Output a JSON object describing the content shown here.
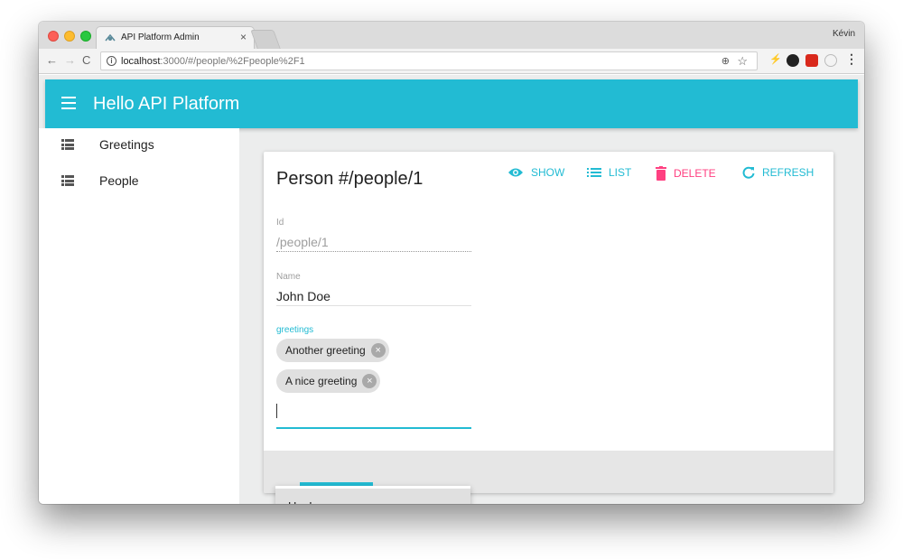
{
  "browser": {
    "tab_title": "API Platform Admin",
    "tab_close": "×",
    "profile_name": "Kévin",
    "url_host": "localhost",
    "url_rest": ":3000/#/people/%2Fpeople%2F1",
    "nav_back": "←",
    "nav_forward": "→",
    "nav_reload": "C",
    "info_glyph": "i",
    "zoom_glyph": "⊕",
    "star_glyph": "☆",
    "bolt_glyph": "⚡",
    "menu_glyph": "⋮"
  },
  "app": {
    "title": "Hello API Platform",
    "accent_color": "#22bbd3",
    "danger_color": "#ff4081"
  },
  "sidebar": {
    "items": [
      {
        "label": "Greetings",
        "icon": "list-icon"
      },
      {
        "label": "People",
        "icon": "list-icon"
      }
    ]
  },
  "card": {
    "title": "Person #/people/1",
    "actions": {
      "show": "SHOW",
      "list": "LIST",
      "delete": "DELETE",
      "refresh": "REFRESH"
    },
    "fields": {
      "id_label": "Id",
      "id_value": "/people/1",
      "name_label": "Name",
      "name_value": "John Doe",
      "greetings_label": "greetings"
    },
    "chips": [
      {
        "label": "Another greeting"
      },
      {
        "label": "A nice greeting"
      }
    ],
    "chip_remove_glyph": "×"
  },
  "dropdown": {
    "options": [
      "Hey!"
    ]
  }
}
